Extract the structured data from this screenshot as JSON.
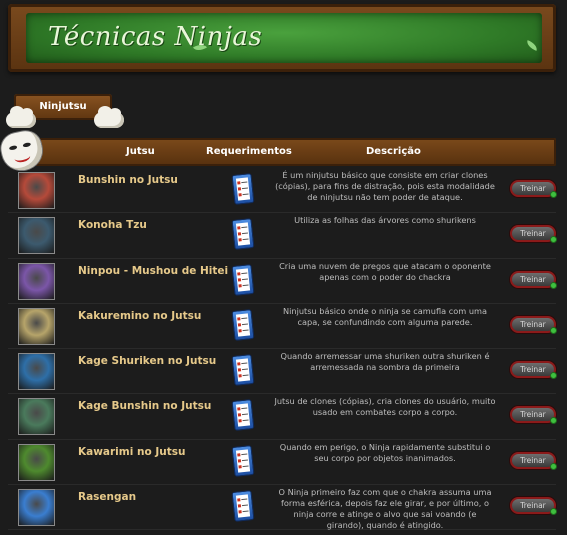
{
  "banner": {
    "title": "Técnicas Ninjas"
  },
  "tab": {
    "label": "Ninjutsu"
  },
  "table": {
    "headers": {
      "jutsu": "Jutsu",
      "requirements": "Requerimentos",
      "description": "Descrição"
    },
    "rows": [
      {
        "name": "Bunshin no Jutsu",
        "description": "É um ninjutsu básico que consiste em criar clones (cópias), para fins de distração, pois esta modalidade de ninjutsu não tem poder de ataque.",
        "button": "Treinar",
        "thumb_color": "#b54a3a"
      },
      {
        "name": "Konoha Tzu",
        "description": "Utiliza as folhas das árvores como shurikens",
        "button": "Treinar",
        "thumb_color": "#3c5a6e"
      },
      {
        "name": "Ninpou - Mushou de Hitei",
        "description": "Cria uma nuvem de pregos que atacam o oponente apenas com o poder do chackra",
        "button": "Treinar",
        "thumb_color": "#7b56a8"
      },
      {
        "name": "Kakuremino no Jutsu",
        "description": "Ninjutsu básico onde o ninja se camufla com uma capa, se confundindo com alguma parede.",
        "button": "Treinar",
        "thumb_color": "#b6a46a"
      },
      {
        "name": "Kage Shuriken no Jutsu",
        "description": "Quando arremessar uma shuriken outra shuriken é arremessada na sombra da primeira",
        "button": "Treinar",
        "thumb_color": "#2e6fa8"
      },
      {
        "name": "Kage Bunshin no Jutsu",
        "description": "Jutsu de clones (cópias), cria clones do usuário, muito usado em combates corpo a corpo.",
        "button": "Treinar",
        "thumb_color": "#4a7a5c"
      },
      {
        "name": "Kawarimi no Jutsu",
        "description": "Quando em perigo, o Ninja rapidamente substitui o seu corpo por objetos inanimados.",
        "button": "Treinar",
        "thumb_color": "#4e8a2e"
      },
      {
        "name": "Rasengan",
        "description": "O Ninja primeiro faz com que o chakra assuma uma forma esférica, depois faz ele girar, e por último, o ninja corre e atinge o alvo que sai voando (e girando), quando é atingido.",
        "button": "Treinar",
        "thumb_color": "#3a7ed0"
      }
    ]
  },
  "icons": {
    "requirements": "checklist-icon",
    "tab_decoration": "cloud-icon",
    "header_decoration": "mask-icon"
  }
}
